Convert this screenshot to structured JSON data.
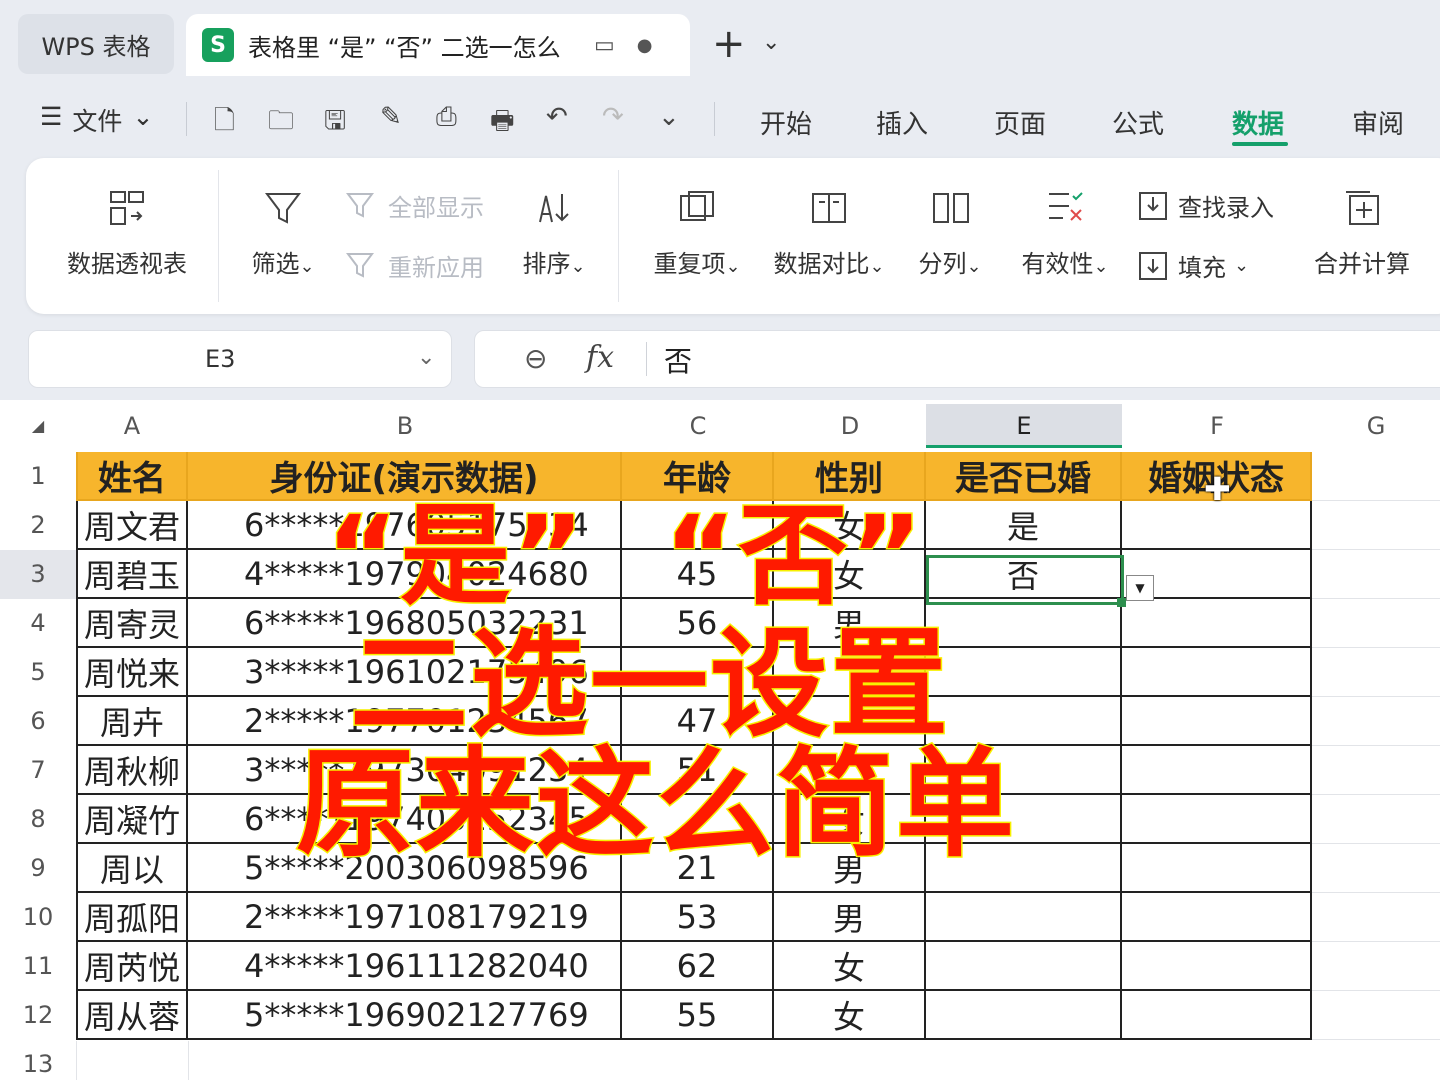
{
  "titlebar": {
    "home_tab": "WPS 表格",
    "doc_icon": "S",
    "doc_title": "表格里 “是” “否” 二选一怎么",
    "new_tab": "+",
    "new_tab_caret": "⌄"
  },
  "menubar": {
    "hamburger": "☰",
    "file": "文件",
    "file_caret": "⌄",
    "tabs": [
      "开始",
      "插入",
      "页面",
      "公式",
      "数据",
      "审阅"
    ],
    "active_tab": "数据"
  },
  "ribbon": {
    "pivot": "数据透视表",
    "filter": "筛选",
    "show_all": "全部显示",
    "reapply": "重新应用",
    "sort": "排序",
    "duplicates": "重复项",
    "compare": "数据对比",
    "split": "分列",
    "validation": "有效性",
    "lookup_entry": "查找录入",
    "fill": "填充",
    "consolidate": "合并计算",
    "caret": "⌄"
  },
  "formula_bar": {
    "cell_ref": "E3",
    "caret": "⌄",
    "fx": "fx",
    "value": "否"
  },
  "sheet": {
    "columns": [
      "A",
      "B",
      "C",
      "D",
      "E",
      "F",
      "G"
    ],
    "selected_column": "E",
    "row_numbers": [
      "1",
      "2",
      "3",
      "4",
      "5",
      "6",
      "7",
      "8",
      "9",
      "10",
      "11",
      "12",
      "13"
    ],
    "headers": [
      "姓名",
      "身份证(演示数据)",
      "年龄",
      "性别",
      "是否已婚",
      "婚姻状态"
    ],
    "rows": [
      [
        "周文君",
        "6*****197605175534",
        "",
        "女",
        "是",
        ""
      ],
      [
        "周碧玉",
        "4*****197904024680",
        "45",
        "女",
        "否",
        ""
      ],
      [
        "周寄灵",
        "6*****196805032231",
        "56",
        "男",
        "",
        ""
      ],
      [
        "周悦来",
        "3*****196102175496",
        "",
        "",
        "",
        ""
      ],
      [
        "周卉",
        "2*****197701234567",
        "47",
        "",
        "",
        ""
      ],
      [
        "周秋柳",
        "3*****197304091234",
        "51",
        "",
        "",
        ""
      ],
      [
        "周凝竹",
        "6*****197403152345",
        "",
        "女",
        "",
        ""
      ],
      [
        "周以",
        "5*****200306098596",
        "21",
        "男",
        "",
        ""
      ],
      [
        "周孤阳",
        "2*****197108179219",
        "53",
        "男",
        "",
        ""
      ],
      [
        "周芮悦",
        "4*****196111282040",
        "62",
        "女",
        "",
        ""
      ],
      [
        "周从蓉",
        "5*****196902127769",
        "55",
        "女",
        "",
        ""
      ]
    ],
    "selected_cell": "E3"
  },
  "overlay": {
    "line1a": "“是”",
    "line1b": "“否”",
    "line2": "二选一设置",
    "line3": "原来这么简单"
  },
  "colors": {
    "accent": "#15a06b",
    "header_fill": "#f7b52c",
    "overlay_text": "#ff1a00",
    "overlay_stroke": "#f7f000"
  }
}
